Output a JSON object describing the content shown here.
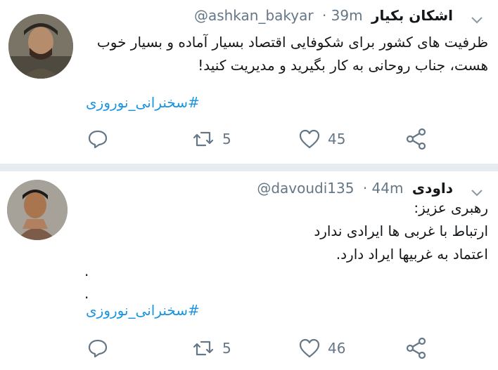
{
  "tweets": [
    {
      "name": "اشکان بکیار",
      "handle": "@ashkan_bakyar",
      "time": "· 39m",
      "lines": [
        "ظرفیت های کشور برای شکوفایی اقتصاد بسیار آماده و بسیار خوب",
        "هست، جناب روحانی به کار بگیرید و مدیریت کنید!"
      ],
      "hashtag": "#سخنرانی_نوروزی",
      "retweets": "5",
      "likes": "45"
    },
    {
      "name": "داودی",
      "handle": "@davoudi135",
      "time": "· 44m",
      "lines": [
        "رهبری عزیز:",
        "ارتباط با غربی ها ایرادی ندارد",
        "اعتماد به غربیها ایراد دارد."
      ],
      "dots": [
        ".",
        "."
      ],
      "hashtag": "#سخنرانی_نوروزی",
      "retweets": "5",
      "likes": "46"
    }
  ],
  "icons": {
    "reply": "reply-icon",
    "retweet": "retweet-icon",
    "like": "heart-icon",
    "share": "share-icon",
    "menu": "chevron-down-icon"
  },
  "colors": {
    "link": "#1b95e0",
    "secondary": "#657786",
    "divider": "#e6ecf0"
  }
}
